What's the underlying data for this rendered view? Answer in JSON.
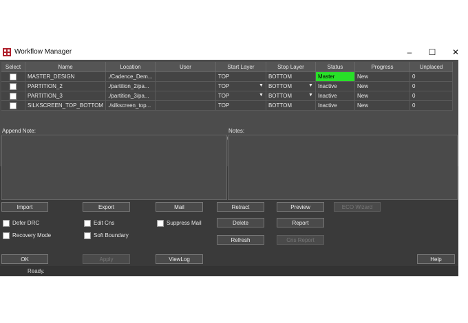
{
  "window": {
    "title": "Workflow Manager",
    "minimize": "–",
    "maximize": "☐",
    "close": "✕"
  },
  "table": {
    "headers": [
      "Select",
      "Name",
      "Location",
      "User",
      "Start Layer",
      "Stop Layer",
      "Status",
      "Progress",
      "Unplaced"
    ],
    "rows": [
      {
        "name": "MASTER_DESIGN",
        "location": "./Cadence_Dem...",
        "user": "",
        "start": "TOP",
        "stop": "BOTTOM",
        "status": "Master",
        "progress": "New",
        "unplaced": "0",
        "dropdowns": false
      },
      {
        "name": "PARTITION_2",
        "location": "./partition_2/pa...",
        "user": "",
        "start": "TOP",
        "stop": "BOTTOM",
        "status": "Inactive",
        "progress": "New",
        "unplaced": "0",
        "dropdowns": true
      },
      {
        "name": "PARTITION_3",
        "location": "./partition_3/pa...",
        "user": "",
        "start": "TOP",
        "stop": "BOTTOM",
        "status": "Inactive",
        "progress": "New",
        "unplaced": "0",
        "dropdowns": true
      },
      {
        "name": "SILKSCREEN_TOP_BOTTOM",
        "location": "./silkscreen_top...",
        "user": "",
        "start": "TOP",
        "stop": "BOTTOM",
        "status": "Inactive",
        "progress": "New",
        "unplaced": "0",
        "dropdowns": false
      }
    ]
  },
  "notes": {
    "append_label": "Append Note:",
    "notes_label": "Notes:"
  },
  "buttons": {
    "import": "Import",
    "export": "Export",
    "mail": "Mail",
    "retract": "Retract",
    "preview": "Preview",
    "eco_wizard": "ECO Wizard",
    "delete": "Delete",
    "report": "Report",
    "refresh": "Refresh",
    "cns_report": "Cns Report",
    "ok": "OK",
    "apply": "Apply",
    "viewlog": "ViewLog",
    "help": "Help"
  },
  "checkboxes": {
    "defer_drc": "Defer DRC",
    "edit_cns": "Edit Cns",
    "suppress_mail": "Suppress Mail",
    "recovery_mode": "Recovery Mode",
    "soft_boundary": "Soft Boundary"
  },
  "status_text": "Ready.",
  "colors": {
    "master_status": "#28e028",
    "background": "#3a3a3a"
  }
}
